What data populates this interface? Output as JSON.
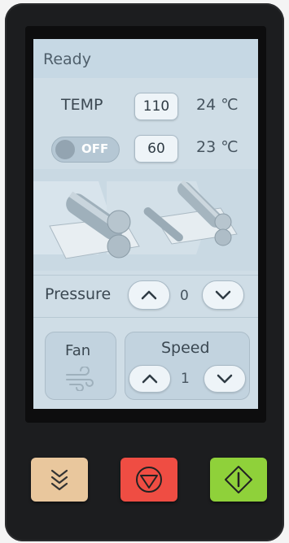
{
  "status": {
    "text": "Ready"
  },
  "temp": {
    "label": "TEMP",
    "set1": "110",
    "actual1": "24 ℃",
    "set2": "60",
    "actual2": "23 ℃"
  },
  "toggle": {
    "label": "OFF"
  },
  "pressure": {
    "label": "Pressure",
    "value": "0"
  },
  "fan": {
    "label": "Fan",
    "icon": "wind-icon"
  },
  "speed": {
    "label": "Speed",
    "value": "1"
  },
  "hardware_buttons": [
    {
      "name": "lower-button",
      "icon": "chevrons-down-icon",
      "color": "#e9c79d"
    },
    {
      "name": "stop-button",
      "icon": "stop-icon",
      "color": "#ef4d43"
    },
    {
      "name": "start-button",
      "icon": "start-icon",
      "color": "#8fd13a"
    }
  ]
}
